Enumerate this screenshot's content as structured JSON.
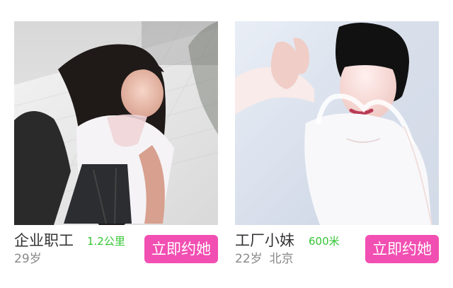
{
  "cards": [
    {
      "title": "企业职工",
      "distance": "1.2公里",
      "age": "29岁",
      "city": "",
      "cta_label": "立即约她"
    },
    {
      "title": "工厂小妹",
      "distance": "600米",
      "age": "22岁",
      "city": "北京",
      "cta_label": "立即约她"
    }
  ],
  "colors": {
    "accent_pink": "#f24fb2",
    "distance_green": "#33c533",
    "title_text": "#333333",
    "meta_text": "#888888"
  },
  "icons": {
    "left_photo": "profile-photo",
    "right_photo": "profile-photo"
  }
}
